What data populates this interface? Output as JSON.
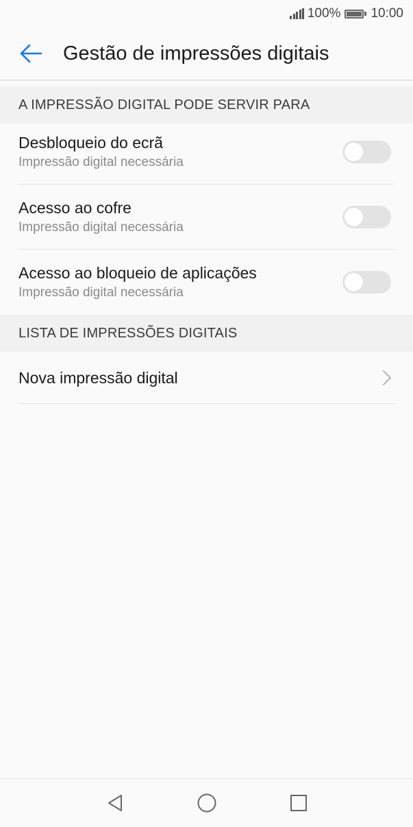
{
  "status_bar": {
    "battery_text": "100%",
    "time": "10:00",
    "signal_icon": "signal-icon",
    "battery_icon": "battery-icon"
  },
  "app_bar": {
    "title": "Gestão de impressões digitais",
    "back_icon": "arrow-left-icon",
    "accent_color": "#1a73e8"
  },
  "sections": [
    {
      "header": "A IMPRESSÃO DIGITAL PODE SERVIR PARA",
      "items": [
        {
          "title": "Desbloqueio do ecrã",
          "subtitle": "Impressão digital necessária",
          "toggle": false
        },
        {
          "title": "Acesso ao cofre",
          "subtitle": "Impressão digital necessária",
          "toggle": false
        },
        {
          "title": "Acesso ao bloqueio de aplicações",
          "subtitle": "Impressão digital necessária",
          "toggle": false
        }
      ]
    },
    {
      "header": "LISTA DE IMPRESSÕES DIGITAIS",
      "items": [
        {
          "title": "Nova impressão digital",
          "chevron_icon": "chevron-right-icon"
        }
      ]
    }
  ],
  "nav_bar": {
    "back_icon": "nav-back-triangle-icon",
    "home_icon": "nav-home-circle-icon",
    "recents_icon": "nav-recents-square-icon"
  }
}
